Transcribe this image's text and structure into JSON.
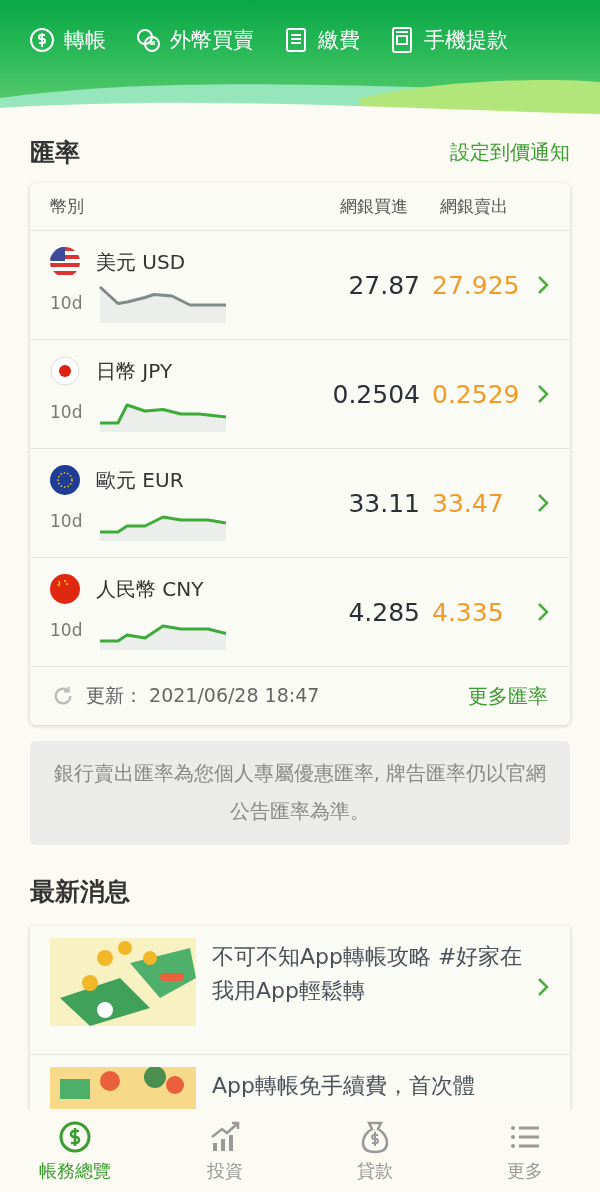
{
  "quick_actions": [
    {
      "label": "轉帳"
    },
    {
      "label": "外幣買賣"
    },
    {
      "label": "繳費"
    },
    {
      "label": "手機提款"
    }
  ],
  "rates": {
    "title": "匯率",
    "alert_link": "設定到價通知",
    "columns": [
      "幣別",
      "網銀買進",
      "網銀賣出"
    ],
    "rows": [
      {
        "name": "美元 USD",
        "period": "10d",
        "buy": "27.87",
        "sell": "27.925",
        "color": "#808a88"
      },
      {
        "name": "日幣 JPY",
        "period": "10d",
        "buy": "0.2504",
        "sell": "0.2529",
        "color": "#3daa3a"
      },
      {
        "name": "歐元 EUR",
        "period": "10d",
        "buy": "33.11",
        "sell": "33.47",
        "color": "#3daa3a"
      },
      {
        "name": "人民幣 CNY",
        "period": "10d",
        "buy": "4.285",
        "sell": "4.335",
        "color": "#3daa3a"
      }
    ],
    "updated": "更新： 2021/06/28 18:47",
    "more_link": "更多匯率"
  },
  "notice": "銀行賣出匯率為您個人專屬優惠匯率, 牌告匯率仍以官網公告匯率為準。",
  "news": {
    "title": "最新消息",
    "items": [
      {
        "text": "不可不知App轉帳攻略 #好家在我用App輕鬆轉"
      },
      {
        "text": "App轉帳免手續費，首次體"
      }
    ]
  },
  "tabs": [
    {
      "label": "帳務總覽",
      "selected": true
    },
    {
      "label": "投資",
      "selected": false
    },
    {
      "label": "貸款",
      "selected": false
    },
    {
      "label": "更多",
      "selected": false
    }
  ]
}
